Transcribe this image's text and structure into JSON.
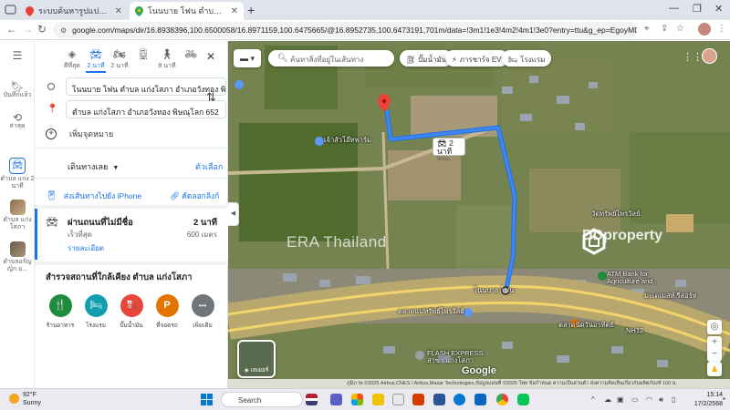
{
  "browser": {
    "tabs": [
      {
        "title": "ระบบค้นหารูปแปลงที่ดิน (LandsMap",
        "active": false
      },
      {
        "title": "โนนบาย โฟน ตำบล แก่งโสภา อำเภอวังทอง",
        "active": true
      }
    ],
    "url": "google.com/maps/dir/16.8938396,100.6500058/16.8971159,100.6475665/@16.8952735,100.6473191,701m/data=!3m1!1e3!4m2!4m1!3e0?entry=ttu&g_ep=EgoyMDI1MDIxMi4wIKXMDSoAS..."
  },
  "sidebar_rail": {
    "menu_label": "",
    "items": [
      {
        "icon": "bookmark-icon",
        "label": "บันทึกแล้ว"
      },
      {
        "icon": "history-icon",
        "label": "ล่าสุด"
      },
      {
        "icon": "car-icon",
        "label": "ตำบล แก่ง 2 นาที"
      },
      {
        "icon": "thumbnail",
        "label": "ตำบล แก่งโสภา"
      },
      {
        "icon": "thumbnail",
        "label": "ตำบลอรัญญิก อ..."
      }
    ]
  },
  "directions": {
    "modes": [
      {
        "icon": "best-route-icon",
        "label": "ดีที่สุด",
        "selected": false
      },
      {
        "icon": "car-icon",
        "label": "2 นาที",
        "selected": true
      },
      {
        "icon": "motorcycle-icon",
        "label": "2 นาที",
        "selected": false
      },
      {
        "icon": "transit-icon",
        "label": "",
        "selected": false
      },
      {
        "icon": "walk-icon",
        "label": "8 นาที",
        "selected": false
      },
      {
        "icon": "bike-icon",
        "label": "",
        "selected": false
      }
    ],
    "origin": "โนนบาย โฟน ตำบล แก่งโสภา อำเภอวังทอง พิ",
    "destination": "ตำบล แก่งโสภา อำเภอวังทอง พิษณุโลก 652",
    "add_stop": "เพิ่มจุดหมาย",
    "leave_now": "เดินทางเลย",
    "options": "ตัวเลือก",
    "send_to_phone": "ส่งเส้นทางไปยัง iPhone",
    "copy_link": "คัดลอกลิงก์",
    "route": {
      "via": "ผ่านถนนที่ไม่มีชื่อ",
      "fastest": "เร็วที่สุด",
      "duration": "2 นาที",
      "distance": "600 เมตร",
      "details": "รายละเอียด"
    },
    "explore_title": "สำรวจสถานที่ใกล้เคียง ตำบล แก่งโสภา",
    "categories": [
      {
        "icon": "restaurant-icon",
        "glyph": "🍴",
        "label": "ร้านอาหาร",
        "color": "#1e8e3e"
      },
      {
        "icon": "hotel-icon",
        "glyph": "🛏",
        "label": "โรงแรม",
        "color": "#129eaf"
      },
      {
        "icon": "gas-station-icon",
        "glyph": "⛽",
        "label": "ปั๊มน้ำมัน",
        "color": "#e8453c"
      },
      {
        "icon": "parking-icon",
        "glyph": "P",
        "label": "ที่จอดรถ",
        "color": "#e37400"
      },
      {
        "icon": "more-icon",
        "glyph": "•••",
        "label": "เพิ่มเติม",
        "color": "#70757a"
      }
    ]
  },
  "map": {
    "search_placeholder": "ค้นหาสิ่งที่อยู่ในเส้นทาง",
    "chips": [
      {
        "icon": "gas-icon",
        "label": "ปั๊มน้ำมัน"
      },
      {
        "icon": "ev-icon",
        "label": "ภารชาร์จ EV"
      },
      {
        "icon": "hotel-icon",
        "label": "โรงแรม"
      }
    ],
    "eta_label": "2 นาที",
    "eta_distance": "600ม.",
    "labels": [
      {
        "text": "เจ้าสัวโอ๊ทฟาร์ม",
        "style": "light"
      },
      {
        "text": "โนนบาย โฟน",
        "style": "light"
      },
      {
        "text": "วัดทรัพย์ไพรวัลย์",
        "style": "light"
      },
      {
        "text": "ATM Bank for Agriculture and...",
        "style": "light"
      },
      {
        "text": "ตลาดแม่ทรัพย์ไพรวัลย์",
        "style": "light"
      },
      {
        "text": "ตลาดนัดวันอาทิตย์",
        "style": "light"
      },
      {
        "text": "มะเดเมสท์ รีสอร์ท",
        "style": "light"
      },
      {
        "text": "FLASH EXPRESS สาขา แก่งโสภา",
        "style": "light"
      },
      {
        "text": "NH12",
        "style": "light"
      }
    ],
    "watermark_era": "ERA Thailand",
    "watermark_dd": "DDproperty",
    "layers_label": "เลเยอร์",
    "google_logo": "Google",
    "attribution": "ภูมิภาพ ©2025 Airbus,CNES / Airbus,Maxar Technologies,ข้อมูลแผนที่ ©2025   ไทย   ข้อกำหนด   ความเป็นส่วนตัว   ส่งความคิดเห็นเกี่ยวกับผลิตภัณฑ์   100 ม."
  },
  "taskbar": {
    "temp": "92°F",
    "weather": "Sunny",
    "search": "Search",
    "time": "15:14",
    "date": "17/2/2568"
  }
}
